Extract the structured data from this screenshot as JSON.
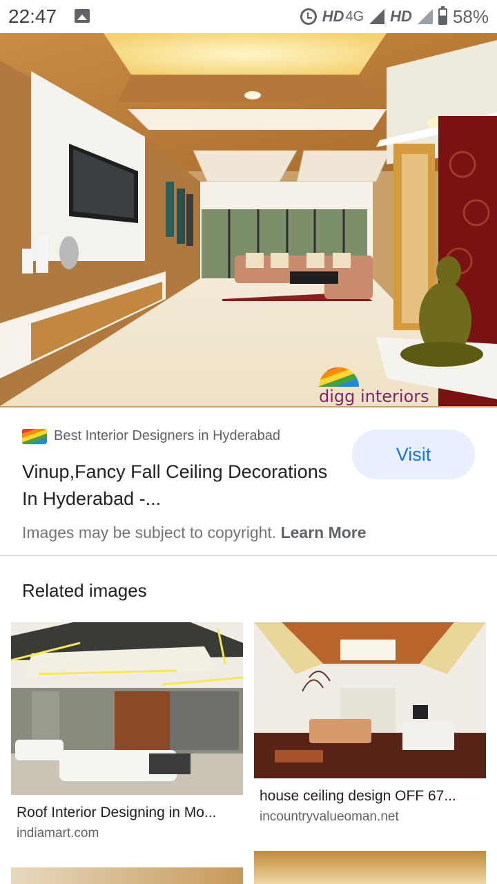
{
  "status_bar": {
    "time": "22:47",
    "network_1": "HD",
    "network_1_sub": "4G",
    "network_2": "HD",
    "battery": "58%",
    "icons": [
      "image-icon",
      "alarm-icon",
      "signal-icon",
      "battery-icon"
    ]
  },
  "hero": {
    "watermark": "digg interiors"
  },
  "result": {
    "source": "Best Interior Designers in Hyderabad",
    "title": "Vinup,Fancy Fall Ceiling Decorations In Hyderabad -...",
    "visit_label": "Visit",
    "copyright_text": "Images may be subject to copyright.",
    "learn_more": "Learn More"
  },
  "related": {
    "heading": "Related images",
    "items": [
      {
        "caption": "Roof Interior Designing in Mo...",
        "domain": "indiamart.com"
      },
      {
        "caption": "house ceiling design OFF 67...",
        "domain": "incountryvalueoman.net"
      }
    ]
  },
  "colors": {
    "accent": "#1a73e8",
    "visit_bg": "#e8f0fe"
  }
}
